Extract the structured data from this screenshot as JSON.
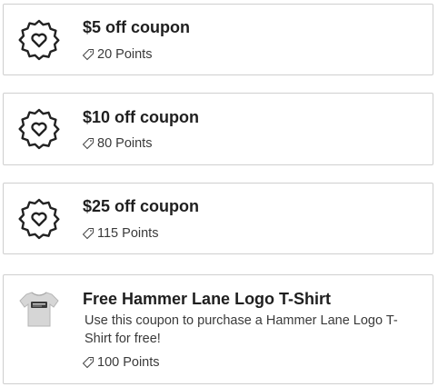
{
  "rewards": [
    {
      "title": "$5 off coupon",
      "points": "20 Points",
      "icon": "heart-badge-icon"
    },
    {
      "title": "$10 off coupon",
      "points": "80 Points",
      "icon": "heart-badge-icon"
    },
    {
      "title": "$25 off coupon",
      "points": "115 Points",
      "icon": "heart-badge-icon"
    },
    {
      "title": "Free Hammer Lane Logo T-Shirt",
      "description": "Use this coupon to purchase a Hammer Lane Logo T-Shirt for free!",
      "points": "100 Points",
      "icon": "tshirt-image"
    }
  ],
  "colors": {
    "border": "#cfcfcf",
    "text": "#1f1f1f",
    "muted": "#3a3a3a"
  }
}
